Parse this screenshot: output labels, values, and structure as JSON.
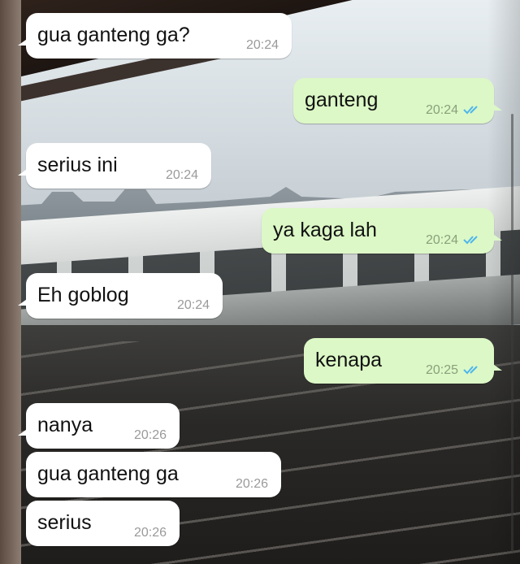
{
  "conversation": {
    "messages": [
      {
        "text": "gua ganteng ga?",
        "time": "20:24",
        "direction": "incoming"
      },
      {
        "text": "ganteng",
        "time": "20:24",
        "direction": "outgoing",
        "status": "read-ticks-icon"
      },
      {
        "text": "serius ini",
        "time": "20:24",
        "direction": "incoming"
      },
      {
        "text": "ya kaga lah",
        "time": "20:24",
        "direction": "outgoing",
        "status": "read-ticks-icon"
      },
      {
        "text": "Eh goblog",
        "time": "20:24",
        "direction": "incoming"
      },
      {
        "text": "kenapa",
        "time": "20:25",
        "direction": "outgoing",
        "status": "read-ticks-icon"
      },
      {
        "text": "nanya",
        "time": "20:26",
        "direction": "incoming"
      },
      {
        "text": "gua ganteng ga",
        "time": "20:26",
        "direction": "incoming"
      },
      {
        "text": "serius",
        "time": "20:26",
        "direction": "incoming"
      }
    ]
  },
  "colors": {
    "incoming_bubble": "#ffffff",
    "outgoing_bubble": "#dcf8c6",
    "read_ticks": "#4fb6ec"
  }
}
